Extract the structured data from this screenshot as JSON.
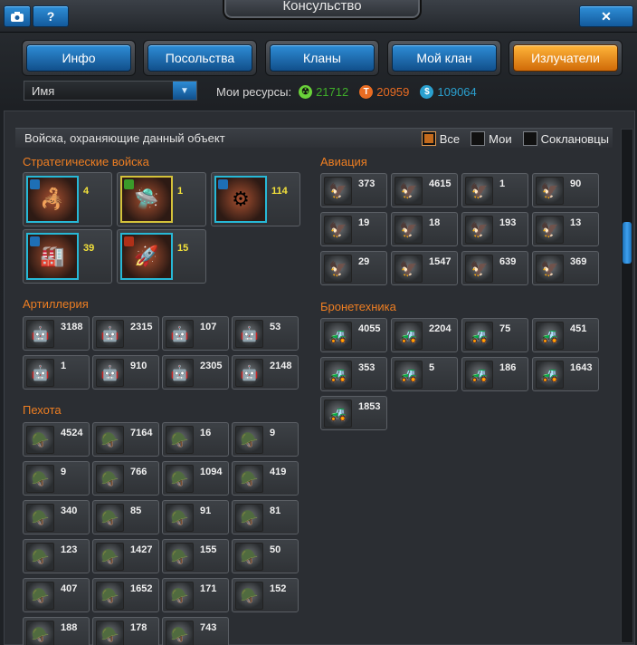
{
  "header": {
    "title": "Консульство",
    "help_label": "?",
    "close_label": "✕"
  },
  "tabs": [
    {
      "label": "Инфо",
      "active": false
    },
    {
      "label": "Посольства",
      "active": false
    },
    {
      "label": "Кланы",
      "active": false
    },
    {
      "label": "Мой клан",
      "active": false
    },
    {
      "label": "Излучатели",
      "active": true
    }
  ],
  "filter": {
    "name_value": "Имя"
  },
  "resources": {
    "label": "Мои ресурсы:",
    "items": [
      {
        "icon": "radiation-icon",
        "value": "21712",
        "color": "#3fae2a"
      },
      {
        "icon": "titanium-icon",
        "value": "20959",
        "color": "#e96c22"
      },
      {
        "icon": "credits-icon",
        "value": "109064",
        "color": "#2aa0cf"
      }
    ]
  },
  "panel": {
    "heading": "Войска, охраняющие данный объект",
    "filters": [
      {
        "label": "Все",
        "checked": true
      },
      {
        "label": "Мои",
        "checked": false
      },
      {
        "label": "Соклановцы",
        "checked": false
      }
    ]
  },
  "sections": {
    "strategic": {
      "title": "Стратегические войска",
      "units": [
        {
          "count": "4",
          "badge": "blue"
        },
        {
          "count": "1",
          "badge": "green"
        },
        {
          "count": "114",
          "badge": "blue"
        },
        {
          "count": "39",
          "badge": "blue"
        },
        {
          "count": "15",
          "badge": "red"
        }
      ]
    },
    "artillery": {
      "title": "Артиллерия",
      "units": [
        "3188",
        "2315",
        "107",
        "53",
        "1",
        "910",
        "2305",
        "2148"
      ]
    },
    "infantry": {
      "title": "Пехота",
      "units": [
        "4524",
        "7164",
        "16",
        "9",
        "9",
        "766",
        "1094",
        "419",
        "340",
        "85",
        "91",
        "81",
        "123",
        "1427",
        "155",
        "50",
        "407",
        "1652",
        "171",
        "152",
        "188",
        "178",
        "743"
      ]
    },
    "aviation": {
      "title": "Авиация",
      "units": [
        "373",
        "4615",
        "1",
        "90",
        "19",
        "18",
        "193",
        "13",
        "29",
        "1547",
        "639",
        "369"
      ]
    },
    "armor": {
      "title": "Бронетехника",
      "units": [
        "4055",
        "2204",
        "75",
        "451",
        "353",
        "5",
        "186",
        "1643",
        "1853"
      ]
    }
  }
}
